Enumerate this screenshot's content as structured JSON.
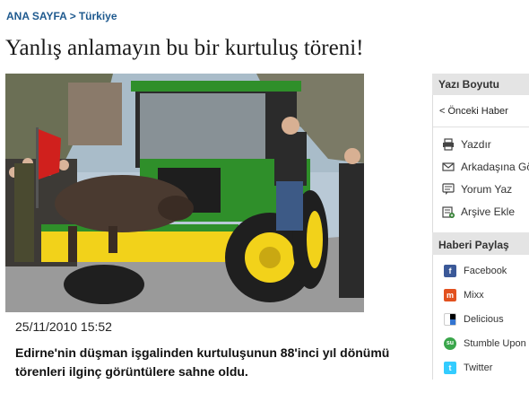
{
  "breadcrumb": {
    "home": "ANA SAYFA",
    "separator": ">",
    "section": "Türkiye"
  },
  "article": {
    "title": "Yanlış anlamayın bu bir kurtuluş töreni!",
    "date": "25/11/2010 15:52",
    "summary": "Edirne'nin düşman işgalinden kurtuluşunun 88'inci yıl dönümü törenleri ilginç görüntülere sahne oldu."
  },
  "sidebar": {
    "font_size_header": "Yazı Boyutu",
    "prev_news": "< Önceki Haber",
    "actions": [
      {
        "label": "Yazdır",
        "icon": "printer-icon"
      },
      {
        "label": "Arkadaşına Gönder",
        "icon": "envelope-icon"
      },
      {
        "label": "Yorum Yaz",
        "icon": "comment-icon"
      },
      {
        "label": "Arşive Ekle",
        "icon": "archive-add-icon"
      }
    ],
    "share_header": "Haberi Paylaş",
    "share": [
      {
        "label": "Facebook",
        "icon": "facebook-icon",
        "color": "#3b5998",
        "glyph": "f"
      },
      {
        "label": "Mixx",
        "icon": "mixx-icon",
        "color": "#e2511f",
        "glyph": "m"
      },
      {
        "label": "Delicious",
        "icon": "delicious-icon",
        "color": "#3274d1",
        "glyph": ""
      },
      {
        "label": "Stumble Upon",
        "icon": "stumbleupon-icon",
        "color": "#3aa64b",
        "glyph": "su"
      },
      {
        "label": "Twitter",
        "icon": "twitter-icon",
        "color": "#33ccff",
        "glyph": "t"
      }
    ]
  },
  "colors": {
    "link": "#1f5a8f",
    "tractor_green": "#2f8f2a",
    "tractor_yellow": "#f2d21a"
  }
}
